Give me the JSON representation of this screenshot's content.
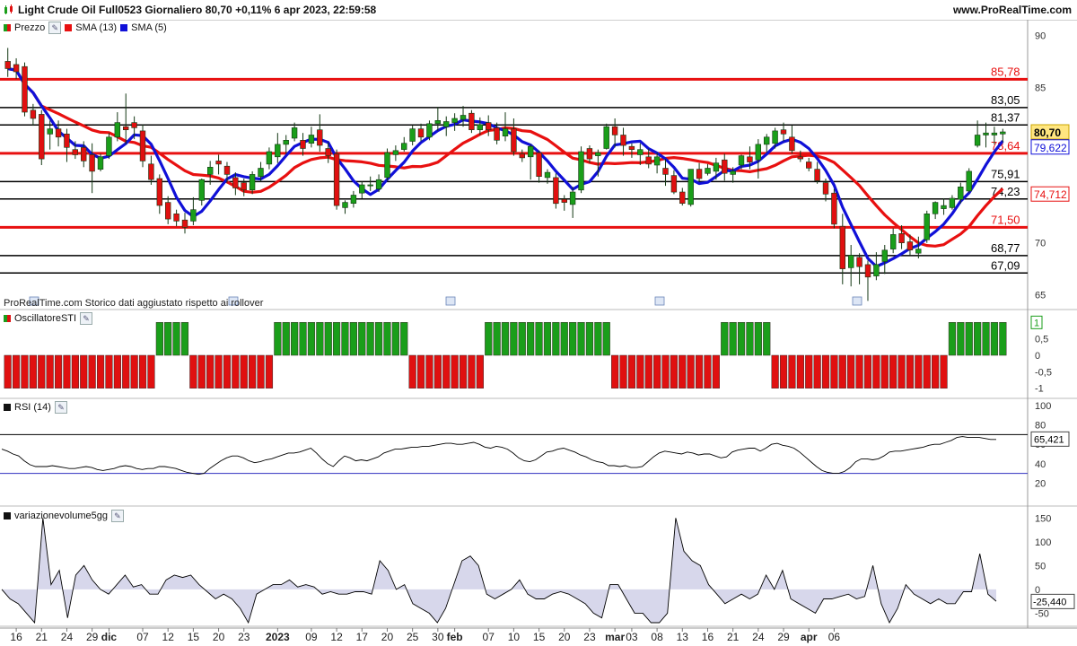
{
  "header": {
    "title": "Light Crude Oil Full0523 Giornaliero 80,70 +0,11% 6 apr 2023, 22:59:58",
    "site": "www.ProRealTime.com"
  },
  "watermark": "ProRealTime.com  Storico dati aggiustato rispetto ai rollover",
  "legend": {
    "price": "Prezzo",
    "sma13": "SMA (13)",
    "sma5": "SMA (5)"
  },
  "colors": {
    "up": "#1a9e1a",
    "down": "#e01010",
    "sma13": "#e81010",
    "sma5": "#1010d8",
    "volume_fill": "#c9c9e4"
  },
  "icons": [
    "wrench-icon",
    "calendar-icon"
  ],
  "chart_data": [
    {
      "type": "candlestick",
      "title": "Light Crude Oil Full0523 Giornaliero",
      "ylim": [
        64,
        91
      ],
      "yticks": [
        65,
        70,
        75,
        80,
        85,
        90
      ],
      "x_labels": [
        "16",
        "21",
        "24",
        "29",
        "dic",
        "07",
        "12",
        "15",
        "20",
        "23",
        "2023",
        "09",
        "12",
        "17",
        "20",
        "25",
        "30",
        "feb",
        "07",
        "10",
        "15",
        "20",
        "23",
        "mar",
        "03",
        "08",
        "13",
        "16",
        "21",
        "24",
        "29",
        "apr",
        "06"
      ],
      "x_label_index": [
        1,
        4,
        7,
        10,
        12,
        16,
        19,
        22,
        25,
        28,
        32,
        36,
        39,
        42,
        45,
        48,
        51,
        53,
        57,
        60,
        63,
        66,
        69,
        72,
        74,
        77,
        80,
        83,
        86,
        89,
        92,
        95,
        98
      ],
      "ohlc": [
        [
          87.5,
          88.8,
          86.0,
          86.8
        ],
        [
          87.2,
          87.8,
          85.8,
          86.5
        ],
        [
          87.0,
          87.4,
          82.2,
          82.6
        ],
        [
          82.8,
          83.4,
          81.3,
          82.0
        ],
        [
          82.4,
          82.8,
          77.5,
          78.1
        ],
        [
          80.5,
          81.8,
          79.0,
          81.0
        ],
        [
          81.0,
          81.8,
          79.3,
          80.2
        ],
        [
          80.5,
          81.0,
          77.8,
          79.2
        ],
        [
          79.0,
          79.8,
          78.1,
          78.5
        ],
        [
          79.2,
          79.8,
          77.3,
          77.9
        ],
        [
          78.5,
          79.6,
          74.8,
          76.9
        ],
        [
          77.1,
          78.6,
          76.9,
          78.3
        ],
        [
          78.4,
          80.6,
          78.1,
          80.2
        ],
        [
          80.2,
          82.6,
          79.8,
          81.6
        ],
        [
          81.2,
          84.4,
          79.5,
          80.9
        ],
        [
          81.6,
          82.2,
          80.0,
          81.1
        ],
        [
          80.8,
          81.4,
          77.3,
          77.9
        ],
        [
          77.6,
          78.4,
          75.6,
          76.1
        ],
        [
          76.2,
          76.6,
          72.8,
          73.6
        ],
        [
          73.9,
          74.5,
          71.8,
          72.3
        ],
        [
          72.8,
          73.2,
          71.6,
          72.1
        ],
        [
          72.2,
          72.9,
          70.9,
          71.5
        ],
        [
          72.1,
          74.4,
          71.7,
          73.2
        ],
        [
          74.1,
          76.2,
          73.6,
          76.1
        ],
        [
          76.6,
          77.9,
          75.6,
          77.3
        ],
        [
          77.9,
          78.5,
          76.6,
          77.6
        ],
        [
          77.4,
          77.8,
          75.8,
          76.6
        ],
        [
          76.3,
          76.8,
          74.6,
          75.3
        ],
        [
          75.8,
          76.2,
          74.5,
          75.1
        ],
        [
          75.1,
          76.9,
          74.7,
          76.6
        ],
        [
          76.4,
          77.8,
          75.9,
          77.2
        ],
        [
          77.6,
          79.2,
          77.1,
          78.8
        ],
        [
          78.3,
          80.6,
          77.7,
          79.5
        ],
        [
          79.5,
          80.4,
          78.6,
          79.9
        ],
        [
          80.1,
          81.6,
          79.8,
          81.1
        ],
        [
          79.9,
          80.6,
          78.4,
          79.1
        ],
        [
          79.6,
          81.2,
          79.2,
          80.4
        ],
        [
          80.9,
          82.4,
          78.8,
          79.4
        ],
        [
          79.1,
          79.7,
          77.7,
          78.4
        ],
        [
          78.6,
          79.0,
          73.2,
          73.6
        ],
        [
          73.4,
          74.1,
          72.8,
          73.9
        ],
        [
          73.8,
          75.0,
          73.4,
          74.6
        ],
        [
          74.8,
          75.9,
          74.3,
          75.6
        ],
        [
          75.6,
          76.4,
          75.0,
          75.6
        ],
        [
          75.2,
          76.6,
          74.9,
          76.1
        ],
        [
          76.3,
          79.1,
          76.0,
          78.7
        ],
        [
          78.5,
          79.4,
          77.9,
          78.9
        ],
        [
          79.0,
          80.2,
          78.8,
          79.6
        ],
        [
          79.8,
          81.3,
          79.4,
          81.0
        ],
        [
          81.0,
          81.5,
          79.8,
          80.2
        ],
        [
          80.2,
          81.8,
          79.9,
          81.5
        ],
        [
          81.5,
          83.1,
          80.8,
          81.8
        ],
        [
          81.2,
          82.2,
          80.3,
          81.7
        ],
        [
          81.6,
          82.5,
          80.8,
          82.0
        ],
        [
          81.9,
          83.2,
          81.2,
          82.3
        ],
        [
          82.5,
          82.8,
          80.6,
          80.9
        ],
        [
          80.9,
          82.1,
          80.4,
          81.4
        ],
        [
          81.6,
          82.3,
          80.3,
          80.9
        ],
        [
          81.1,
          81.6,
          79.5,
          79.9
        ],
        [
          80.3,
          82.6,
          79.8,
          81.0
        ],
        [
          81.0,
          82.0,
          78.4,
          78.8
        ],
        [
          78.6,
          79.0,
          77.8,
          78.2
        ],
        [
          78.3,
          79.5,
          76.1,
          79.3
        ],
        [
          78.7,
          78.9,
          75.8,
          76.4
        ],
        [
          76.3,
          77.1,
          75.7,
          76.8
        ],
        [
          76.3,
          76.7,
          73.3,
          73.8
        ],
        [
          74.2,
          74.6,
          73.1,
          73.9
        ],
        [
          73.7,
          75.4,
          72.4,
          74.9
        ],
        [
          75.1,
          79.3,
          74.8,
          78.8
        ],
        [
          79.1,
          79.4,
          77.7,
          78.1
        ],
        [
          78.4,
          79.0,
          76.4,
          78.7
        ],
        [
          79.1,
          81.5,
          79.0,
          81.2
        ],
        [
          81.2,
          82.0,
          79.2,
          80.4
        ],
        [
          80.4,
          81.1,
          78.4,
          79.4
        ],
        [
          79.3,
          79.6,
          78.2,
          79.0
        ],
        [
          78.5,
          79.6,
          77.5,
          79.0
        ],
        [
          78.3,
          79.1,
          77.2,
          77.6
        ],
        [
          77.5,
          78.7,
          76.7,
          78.3
        ],
        [
          77.2,
          78.1,
          75.5,
          76.6
        ],
        [
          76.5,
          77.0,
          74.7,
          74.9
        ],
        [
          74.9,
          75.3,
          73.6,
          73.8
        ],
        [
          73.7,
          77.0,
          73.5,
          77.1
        ],
        [
          77.1,
          77.7,
          75.9,
          76.2
        ],
        [
          76.7,
          77.6,
          76.5,
          77.2
        ],
        [
          76.9,
          78.2,
          76.1,
          77.7
        ],
        [
          78.0,
          78.6,
          76.0,
          76.7
        ],
        [
          76.6,
          77.3,
          75.8,
          76.9
        ],
        [
          77.5,
          78.5,
          77.1,
          78.4
        ],
        [
          78.3,
          79.3,
          77.1,
          77.8
        ],
        [
          78.0,
          80.0,
          76.2,
          79.5
        ],
        [
          79.5,
          80.5,
          78.7,
          80.2
        ],
        [
          79.6,
          81.1,
          79.1,
          80.8
        ],
        [
          80.9,
          81.6,
          79.8,
          80.5
        ],
        [
          80.2,
          81.3,
          78.6,
          78.9
        ],
        [
          78.3,
          78.9,
          77.8,
          78.1
        ],
        [
          77.8,
          78.2,
          76.9,
          77.2
        ],
        [
          77.1,
          77.8,
          75.7,
          76.0
        ],
        [
          75.8,
          76.2,
          74.0,
          74.7
        ],
        [
          74.8,
          75.2,
          71.4,
          71.8
        ],
        [
          71.6,
          72.8,
          66.0,
          67.5
        ],
        [
          67.6,
          69.8,
          65.8,
          68.8
        ],
        [
          68.6,
          69.0,
          66.0,
          67.7
        ],
        [
          67.9,
          68.3,
          64.4,
          66.7
        ],
        [
          66.8,
          69.1,
          66.4,
          67.9
        ],
        [
          68.2,
          69.8,
          67.0,
          69.3
        ],
        [
          69.4,
          71.4,
          69.0,
          70.8
        ],
        [
          70.9,
          71.7,
          69.4,
          70.0
        ],
        [
          70.1,
          70.8,
          68.8,
          69.3
        ],
        [
          69.0,
          70.6,
          68.5,
          69.4
        ],
        [
          70.3,
          73.1,
          70.0,
          72.8
        ],
        [
          72.8,
          74.0,
          72.3,
          73.9
        ],
        [
          73.3,
          74.3,
          72.7,
          73.6
        ],
        [
          73.4,
          74.6,
          73.2,
          74.3
        ],
        [
          74.2,
          75.8,
          73.8,
          75.4
        ],
        [
          75.0,
          77.2,
          74.8,
          76.9
        ],
        [
          79.4,
          81.8,
          79.2,
          80.4
        ],
        [
          80.4,
          81.6,
          79.2,
          80.6
        ],
        [
          80.4,
          81.2,
          79.5,
          80.6
        ],
        [
          80.5,
          81.0,
          79.7,
          80.7
        ]
      ],
      "sma13": {
        "name": "SMA (13)",
        "values_note": "computed from close"
      },
      "sma5": {
        "name": "SMA (5)",
        "values_note": "computed from close"
      },
      "hlines": [
        {
          "value": 85.78,
          "label": "85,78",
          "color": "red",
          "width": 3
        },
        {
          "value": 83.05,
          "label": "83,05",
          "color": "black",
          "width": 1.5
        },
        {
          "value": 81.37,
          "label": "81,37",
          "color": "black",
          "width": 1.5
        },
        {
          "value": 78.64,
          "label": "78,64",
          "color": "red",
          "width": 3
        },
        {
          "value": 75.91,
          "label": "75,91",
          "color": "black",
          "width": 1.5
        },
        {
          "value": 74.23,
          "label": "74,23",
          "color": "black",
          "width": 1.5
        },
        {
          "value": 71.5,
          "label": "71,50",
          "color": "red",
          "width": 3
        },
        {
          "value": 68.77,
          "label": "68,77",
          "color": "black",
          "width": 1.5
        },
        {
          "value": 67.09,
          "label": "67,09",
          "color": "black",
          "width": 1.5
        }
      ],
      "last_price": "80,70",
      "sma5_last": "79,622",
      "sma13_last": "74,712"
    },
    {
      "type": "bar",
      "title": "OscillatoreSTI",
      "ylim": [
        -1.2,
        1.2
      ],
      "yticks": [
        "1",
        "0,5",
        "0",
        "-0,5",
        "-1"
      ],
      "values": [
        -1,
        -1,
        -1,
        -1,
        -1,
        -1,
        -1,
        -1,
        -1,
        -1,
        -1,
        -1,
        -1,
        -1,
        -1,
        -1,
        -1,
        -1,
        1,
        1,
        1,
        1,
        -1,
        -1,
        -1,
        -1,
        -1,
        -1,
        -1,
        -1,
        -1,
        -1,
        1,
        1,
        1,
        1,
        1,
        1,
        1,
        1,
        1,
        1,
        1,
        1,
        1,
        1,
        1,
        1,
        -1,
        -1,
        -1,
        -1,
        -1,
        -1,
        -1,
        -1,
        -1,
        1,
        1,
        1,
        1,
        1,
        1,
        1,
        1,
        1,
        1,
        1,
        1,
        1,
        1,
        1,
        -1,
        -1,
        -1,
        -1,
        -1,
        -1,
        -1,
        -1,
        -1,
        -1,
        -1,
        -1,
        -1,
        1,
        1,
        1,
        1,
        1,
        1,
        -1,
        -1,
        -1,
        -1,
        -1,
        -1,
        -1,
        -1,
        -1,
        -1,
        -1,
        -1,
        -1,
        -1,
        -1,
        -1,
        -1,
        -1,
        -1,
        -1,
        -1,
        1,
        1,
        1,
        1,
        1,
        1,
        1,
        1,
        1,
        1,
        1,
        1
      ],
      "last_value": "1"
    },
    {
      "type": "line",
      "title": "RSI (14)",
      "ylim": [
        0,
        100
      ],
      "yticks": [
        20,
        40,
        60,
        80,
        100
      ],
      "levels": [
        30,
        70
      ],
      "values": [
        55,
        53,
        50,
        48,
        43,
        39,
        37,
        37,
        37,
        38,
        37,
        36,
        35,
        35,
        36,
        37,
        36,
        34,
        33,
        34,
        35,
        37,
        38,
        37,
        35,
        34,
        35,
        35,
        37,
        37,
        36,
        35,
        33,
        31,
        30,
        29,
        30,
        35,
        39,
        43,
        46,
        48,
        48,
        46,
        43,
        41,
        42,
        44,
        45,
        47,
        49,
        51,
        51,
        52,
        54,
        56,
        51,
        45,
        40,
        37,
        43,
        48,
        46,
        43,
        44,
        43,
        45,
        47,
        51,
        53,
        55,
        55,
        56,
        57,
        57,
        58,
        58,
        59,
        60,
        61,
        61,
        60,
        60,
        61,
        62,
        60,
        57,
        56,
        58,
        57,
        55,
        51,
        46,
        43,
        42,
        44,
        48,
        52,
        53,
        55,
        56,
        54,
        52,
        49,
        47,
        44,
        42,
        41,
        38,
        38,
        37,
        38,
        36,
        36,
        37,
        42,
        47,
        51,
        53,
        52,
        51,
        50,
        52,
        51,
        49,
        50,
        50,
        48,
        46,
        47,
        52,
        54,
        55,
        56,
        56,
        53,
        56,
        60,
        61,
        59,
        58,
        56,
        52,
        47,
        42,
        37,
        33,
        31,
        30,
        30,
        32,
        36,
        42,
        45,
        45,
        44,
        45,
        48,
        52,
        53,
        53,
        54,
        55,
        56,
        57,
        59,
        60,
        60,
        62,
        64,
        67,
        68,
        67,
        67,
        67,
        66,
        65,
        65
      ],
      "last_value": "65,421"
    },
    {
      "type": "area",
      "title": "variazionevolume5gg",
      "ylim": [
        -70,
        160
      ],
      "yticks": [
        150,
        100,
        50,
        0,
        -50
      ],
      "values": [
        0,
        -20,
        -30,
        -50,
        -70,
        150,
        10,
        40,
        -60,
        30,
        50,
        20,
        0,
        -10,
        10,
        30,
        5,
        10,
        -10,
        -10,
        20,
        30,
        25,
        30,
        10,
        -5,
        -20,
        -10,
        -20,
        -40,
        -70,
        -10,
        0,
        10,
        10,
        20,
        5,
        10,
        5,
        -10,
        -5,
        -10,
        -10,
        -5,
        -5,
        -10,
        60,
        40,
        0,
        10,
        -30,
        -40,
        -50,
        -70,
        -40,
        10,
        60,
        70,
        50,
        -10,
        -20,
        -10,
        0,
        20,
        -10,
        -20,
        -20,
        -10,
        -5,
        -10,
        -20,
        -30,
        -50,
        -60,
        10,
        10,
        -20,
        -50,
        -50,
        -70,
        -70,
        -50,
        150,
        80,
        60,
        50,
        10,
        -10,
        -30,
        -20,
        -10,
        -20,
        -10,
        30,
        0,
        40,
        -20,
        -30,
        -40,
        -50,
        -20,
        -20,
        -15,
        -10,
        -20,
        -15,
        50,
        -30,
        -70,
        -40,
        10,
        -10,
        -20,
        -30,
        -20,
        -30,
        -30,
        -5,
        -5,
        75,
        -10,
        -25
      ],
      "last_value": "-25,440"
    }
  ]
}
